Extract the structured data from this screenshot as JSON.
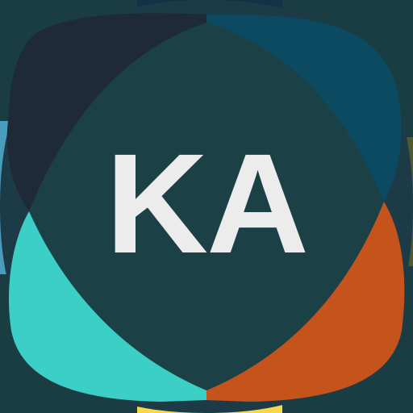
{
  "app_icon": {
    "monogram": "KA",
    "colors": {
      "background": "#1a3d44",
      "top_left_petal": "#1f2a38",
      "top_right_petal": "#0b4a60",
      "bottom_left_petal": "#3ccfc6",
      "bottom_right_petal": "#c4531c",
      "left_edge": "#4a9cbc",
      "right_edge": "#4f5a34",
      "bottom_edge": "#f7d848",
      "center_diamond": "#1b4146",
      "monogram_text": "#ececec"
    }
  }
}
